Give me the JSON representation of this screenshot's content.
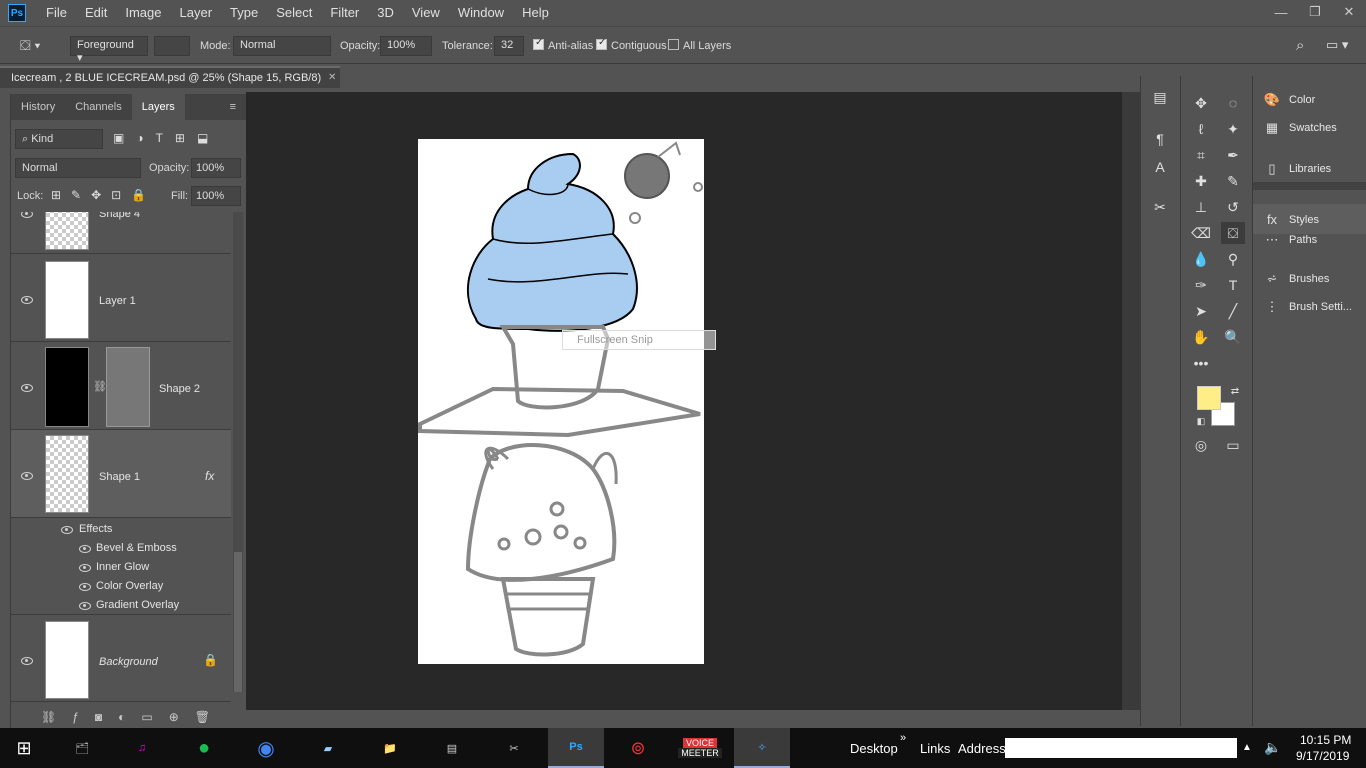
{
  "menubar": {
    "logo": "Ps",
    "items": [
      "File",
      "Edit",
      "Image",
      "Layer",
      "Type",
      "Select",
      "Filter",
      "3D",
      "View",
      "Window",
      "Help"
    ]
  },
  "options": {
    "fill_source": "Foreground",
    "mode_label": "Mode:",
    "mode_value": "Normal",
    "opacity_label": "Opacity:",
    "opacity_value": "100%",
    "tolerance_label": "Tolerance:",
    "tolerance_value": "32",
    "antialias_label": "Anti-alias",
    "contiguous_label": "Contiguous",
    "alllayers_label": "All Layers"
  },
  "document": {
    "tab_title": "Icecream , 2 BLUE ICECREAM.psd @ 25% (Shape 15, RGB/8)",
    "snip_hint": "Fullscreen Snip"
  },
  "layers_panel": {
    "tabs": [
      "History",
      "Channels",
      "Layers"
    ],
    "active_tab": "Layers",
    "filter_kind": "Kind",
    "blend_mode": "Normal",
    "opacity_label": "Opacity:",
    "opacity_value": "100%",
    "lock_label": "Lock:",
    "fill_label": "Fill:",
    "fill_value": "100%",
    "layers": [
      {
        "name": "Shape 4"
      },
      {
        "name": "Layer 1"
      },
      {
        "name": "Shape 2"
      },
      {
        "name": "Shape 1",
        "fx": "fx"
      },
      {
        "name": "Background"
      }
    ],
    "effects_label": "Effects",
    "effects": [
      "Bevel & Emboss",
      "Inner Glow",
      "Color Overlay",
      "Gradient Overlay"
    ]
  },
  "right_panels": {
    "items": [
      "Color",
      "Swatches",
      "Libraries",
      "Styles",
      "Paths",
      "Brushes",
      "Brush Setti..."
    ]
  },
  "colors": {
    "foreground": "#ffee88",
    "background": "#ffffff",
    "icecream_blue": "#a8cdf0"
  },
  "taskbar": {
    "desktop_label": "Desktop",
    "links_label": "Links",
    "address_label": "Address",
    "time": "10:15 PM",
    "date": "9/17/2019",
    "voicemeeter_top": "VOICE",
    "voicemeeter_bottom": "MEETER"
  }
}
